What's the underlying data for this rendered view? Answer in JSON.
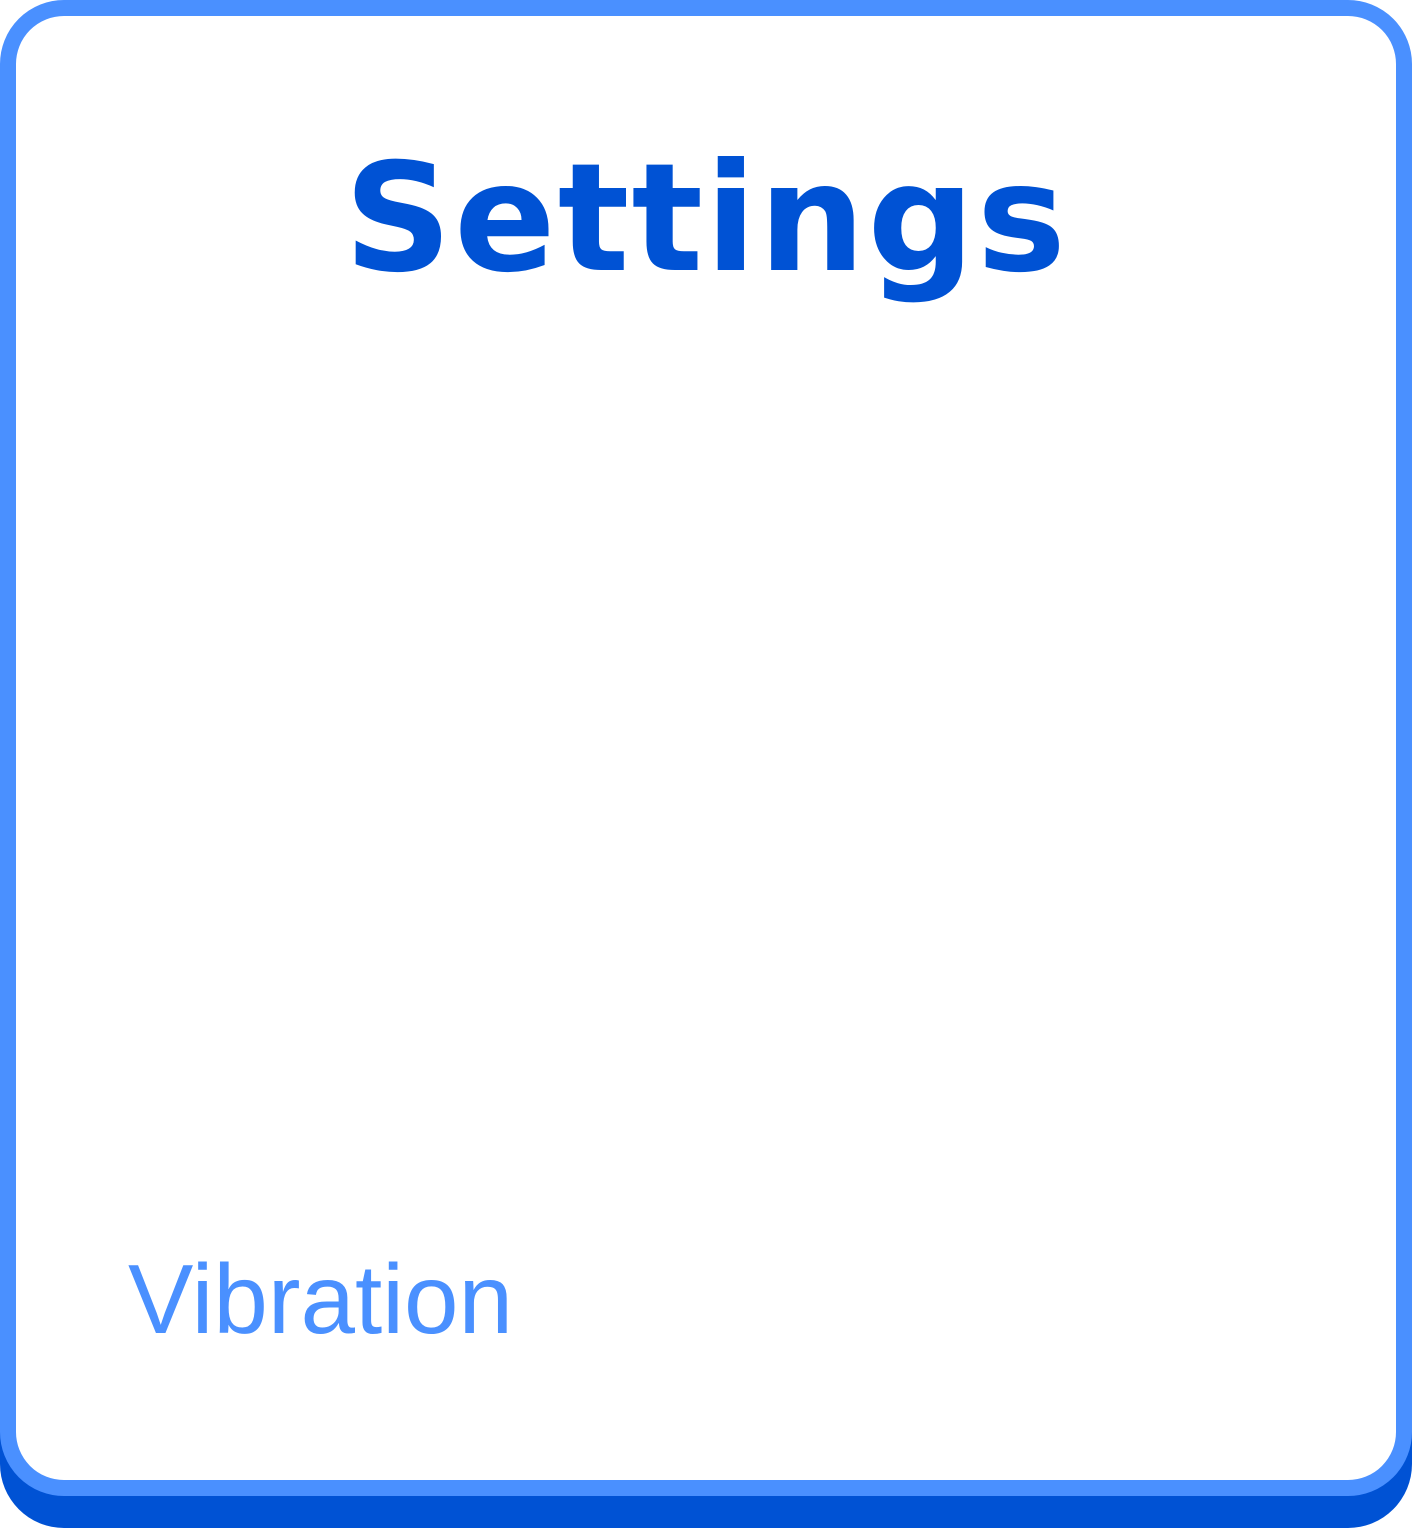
{
  "header": {
    "title": "Settings"
  },
  "settings": {
    "items": [
      {
        "label": "Vibration"
      }
    ]
  },
  "colors": {
    "border": "#4a90ff",
    "shadow": "#0052d4",
    "title": "#0052d4",
    "label": "#4a90ff",
    "background": "#ffffff"
  }
}
